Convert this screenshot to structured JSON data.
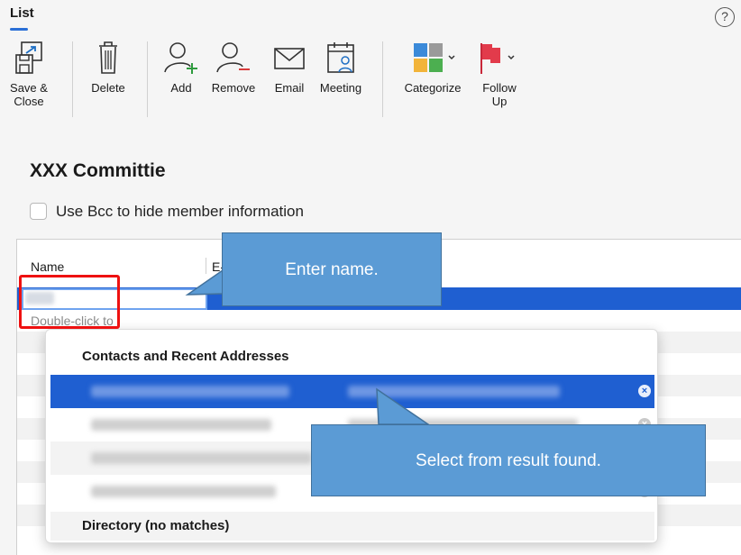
{
  "ribbon": {
    "tab_label": "List",
    "help_glyph": "?",
    "buttons": {
      "save_close": "Save &\nClose",
      "delete": "Delete",
      "add": "Add",
      "remove": "Remove",
      "email": "Email",
      "meeting": "Meeting",
      "categorize": "Categorize",
      "follow_up": "Follow\nUp"
    },
    "colors": {
      "add_plus": "#2e9b3e",
      "remove_minus": "#d83b3b",
      "flag": "#e23b4b"
    }
  },
  "form": {
    "title": "XXX Committie",
    "bcc_checkbox_label": "Use Bcc to hide member information",
    "bcc_checked": false
  },
  "members_table": {
    "columns": {
      "name": "Name",
      "email": "E-"
    },
    "hint_text": "Double-click to"
  },
  "autocomplete": {
    "section_title": "Contacts and Recent Addresses",
    "directory_label": "Directory (no matches)",
    "remove_glyph": "×"
  },
  "annotations": {
    "enter_name": "Enter name.",
    "select_result": "Select from result found."
  },
  "colors": {
    "selection": "#1f5fd1",
    "callout_fill": "#5b9bd5",
    "callout_border": "#41719c",
    "highlight_box": "#ee1111",
    "tab_accent": "#2a6fd6"
  }
}
